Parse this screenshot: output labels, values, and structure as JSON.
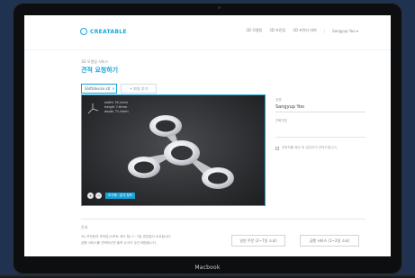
{
  "device": {
    "brand": "Macbook"
  },
  "nav": {
    "logo": "CREATABLE",
    "items": [
      "3D 모델링",
      "3D 프린팅",
      "3D 프린터 대여"
    ],
    "user": "Sangyup Yoo",
    "caret": "▾"
  },
  "page": {
    "crumb": "3D 모델링 서비스",
    "title": "견적 요청하기"
  },
  "controls": {
    "select_value": "Shiftdevice.stl",
    "select_close": "×",
    "add_file_label": "+ 파일 추가"
  },
  "viewer": {
    "dims": [
      "width 76.1mm",
      "height 7.6mm",
      "depth 71.4mm"
    ],
    "zoom_in": "+",
    "zoom_out": "−",
    "reset_label": "초기화 · 분석 정보"
  },
  "panel": {
    "name_label": "성명",
    "name_value": "Sangyup Yoo",
    "field2_label": "전화번호",
    "checkbox_label": "연락처를 확인 후 담당자가 연락드립니다."
  },
  "bottom": {
    "heading": "안내",
    "line1": "3D 프린팅의 후작업(서포트 제거 등) 2~7일 영업일이 소요됩니다.",
    "line2": "급행 서비스를 선택하시면 출력 순서가 우선 배정됩니다.",
    "option1": "일반 주문 (2~7일 소요)",
    "option2": "급행 서비스 (1~2일 소요)"
  },
  "colors": {
    "accent": "#16a3da",
    "frame": "#0d0e10",
    "background": "#1f3350"
  }
}
